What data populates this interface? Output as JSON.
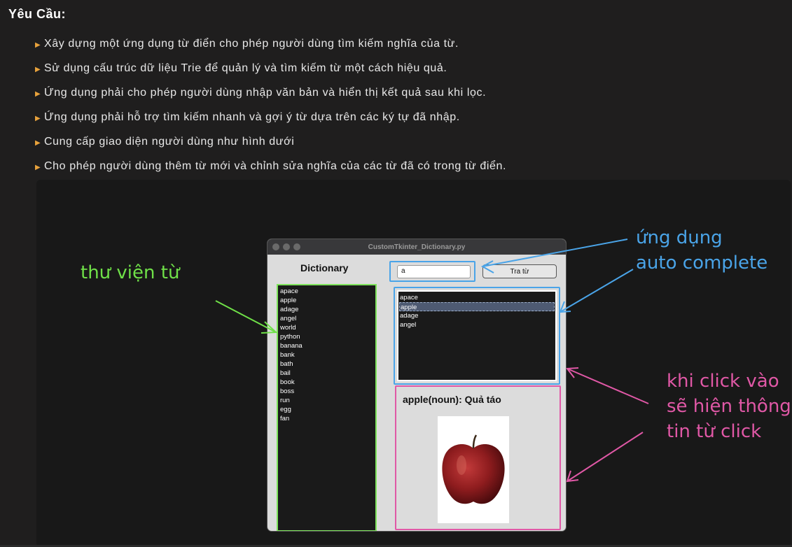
{
  "heading": "Yêu Cầu:",
  "requirements": [
    "Xây dựng một ứng dụng từ điển cho phép người dùng tìm kiếm nghĩa của từ.",
    "Sử dụng cấu trúc dữ liệu Trie để quản lý và tìm kiếm từ một cách hiệu quả.",
    "Ứng dụng phải cho phép người dùng nhập văn bản và hiển thị kết quả sau khi lọc.",
    "Ứng dụng phải hỗ trợ tìm kiếm nhanh và gợi ý từ dựa trên các ký tự đã nhập.",
    "Cung cấp giao diện người dùng như hình dưới",
    "Cho phép người dùng thêm từ mới và chỉnh sửa nghĩa của các từ đã có trong từ điển."
  ],
  "app": {
    "window_title": "CustomTkinter_Dictionary.py",
    "dictionary_label": "Dictionary",
    "library_words": [
      "apace",
      "apple",
      "adage",
      "angel",
      "world",
      "python",
      "banana",
      "bank",
      "bath",
      "bail",
      "book",
      "boss",
      "run",
      "egg",
      "fan"
    ],
    "search_value": "a",
    "search_button": "Tra từ",
    "suggestions": [
      "apace",
      "apple",
      "adage",
      "angel"
    ],
    "selected_suggestion": "apple",
    "detail_text": "apple(noun): Quả táo",
    "detail_image": "red-apple"
  },
  "annotations": {
    "library": "thư viện từ",
    "autocomplete": [
      "ứng dụng",
      "auto complete"
    ],
    "click_info": [
      "khi click vào",
      "sẽ hiện thông",
      "tin từ click"
    ]
  },
  "colors": {
    "bullet_marker": "#e8a23c",
    "library_frame": "#7ee35b",
    "autocomplete_frame": "#4aa4e8",
    "detail_frame": "#e058a6"
  }
}
